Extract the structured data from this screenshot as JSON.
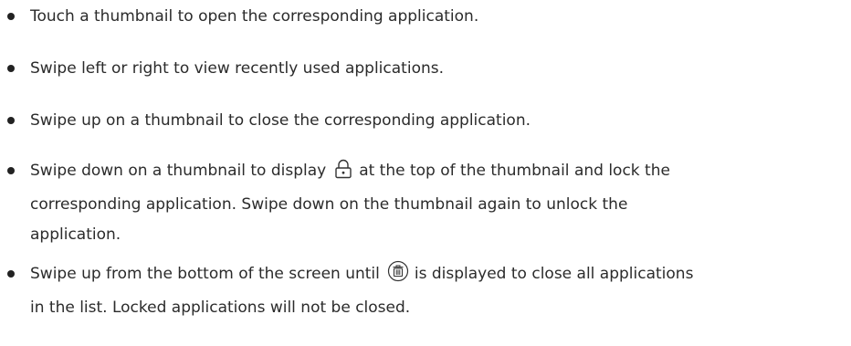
{
  "bullets": [
    {
      "text": "Touch a thumbnail to open the corresponding application."
    },
    {
      "text": "Swipe left or right to view recently used applications."
    },
    {
      "text": "Swipe up on a thumbnail to close the corresponding application."
    },
    {
      "before": "Swipe down on a thumbnail to display",
      "icon": "lock-icon",
      "after_line1": "at the top of the thumbnail and lock the",
      "line2": "corresponding application. Swipe down on the thumbnail again to unlock the",
      "line3": "application."
    },
    {
      "before": "Swipe up from the bottom of the screen until",
      "icon": "trash-icon",
      "after_line1": "is displayed to close all applications",
      "line2": "in the list. Locked applications will not be closed."
    }
  ]
}
